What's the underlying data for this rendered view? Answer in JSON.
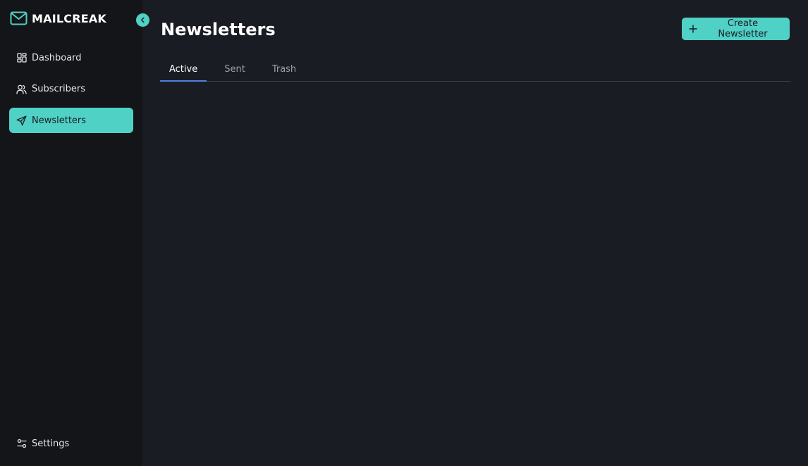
{
  "brand": {
    "name": "MAILCREAK",
    "logo_icon": "mail-icon",
    "accent_color": "#4fd1c5"
  },
  "sidebar": {
    "collapse_icon": "chevron-left-icon",
    "items": [
      {
        "label": "Dashboard",
        "icon": "dashboard-icon",
        "active": false
      },
      {
        "label": "Subscribers",
        "icon": "users-icon",
        "active": false
      },
      {
        "label": "Newsletters",
        "icon": "send-icon",
        "active": true
      }
    ],
    "settings": {
      "label": "Settings",
      "icon": "sliders-icon"
    }
  },
  "main": {
    "title": "Newsletters",
    "create_button": {
      "label": "Create Newsletter",
      "icon": "plus-icon"
    },
    "tabs": [
      {
        "label": "Active",
        "active": true
      },
      {
        "label": "Sent",
        "active": false
      },
      {
        "label": "Trash",
        "active": false
      }
    ],
    "tab_indicator_color": "#4f7fe0"
  }
}
